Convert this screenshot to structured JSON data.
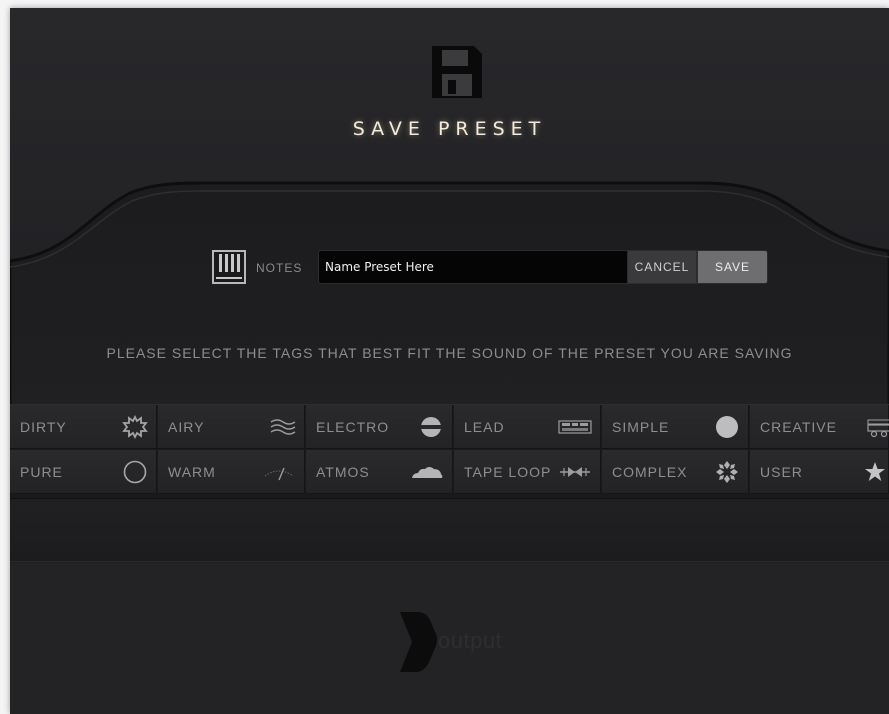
{
  "title": "SAVE PRESET",
  "notes_label": "NOTES",
  "name_input": {
    "value": "Name Preset Here"
  },
  "buttons": {
    "cancel": "CANCEL",
    "save": "SAVE"
  },
  "instruction": "PLEASE SELECT THE TAGS THAT BEST FIT THE SOUND OF THE PRESET YOU ARE SAVING",
  "tags": [
    {
      "label": "DIRTY",
      "icon": "splat-icon"
    },
    {
      "label": "AIRY",
      "icon": "waves-icon"
    },
    {
      "label": "ELECTRO",
      "icon": "split-circle-icon"
    },
    {
      "label": "LEAD",
      "icon": "keyboard-icon"
    },
    {
      "label": "SIMPLE",
      "icon": "filled-circle-icon"
    },
    {
      "label": "CREATIVE",
      "icon": "synth-icon"
    },
    {
      "label": "PURE",
      "icon": "empty-circle-icon"
    },
    {
      "label": "WARM",
      "icon": "meter-icon"
    },
    {
      "label": "ATMOS",
      "icon": "cloud-icon"
    },
    {
      "label": "TAPE LOOP",
      "icon": "tape-icon"
    },
    {
      "label": "COMPLEX",
      "icon": "snowflake-icon"
    },
    {
      "label": "USER",
      "icon": "star-icon"
    }
  ],
  "logo": {
    "text": "output"
  },
  "colors": {
    "background": "#1f1f21",
    "title_glow": "#f4ecd6",
    "save_button": "#6e6e70"
  }
}
